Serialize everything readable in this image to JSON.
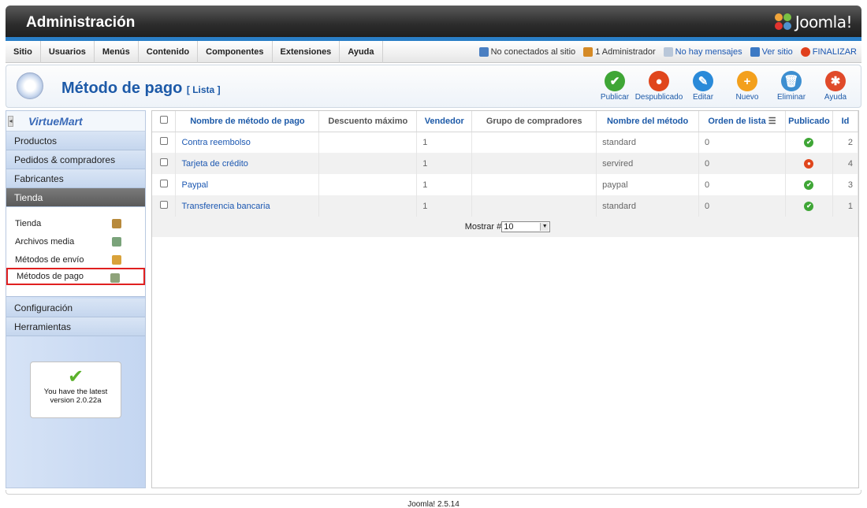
{
  "header": {
    "title": "Administración",
    "logo_text": "Joomla!"
  },
  "menu": [
    "Sitio",
    "Usuarios",
    "Menús",
    "Contenido",
    "Componentes",
    "Extensiones",
    "Ayuda"
  ],
  "status": {
    "visitors": "No conectados al sitio",
    "admins": "1 Administrador",
    "messages": "No hay mensajes",
    "view_site": "Ver sitio",
    "logout": "FINALIZAR"
  },
  "page": {
    "title": "Método de pago",
    "subtitle": "[ Lista ]"
  },
  "toolbar": [
    {
      "label": "Publicar",
      "icon": "check-icon",
      "color": "#3fa636",
      "glyph": "✔"
    },
    {
      "label": "Despublicado",
      "icon": "unpublish-icon",
      "color": "#e0461c",
      "glyph": "●"
    },
    {
      "label": "Editar",
      "icon": "pencil-icon",
      "color": "#2a8ad9",
      "glyph": "✎"
    },
    {
      "label": "Nuevo",
      "icon": "plus-icon",
      "color": "#f3a01d",
      "glyph": "+"
    },
    {
      "label": "Eliminar",
      "icon": "trash-icon",
      "color": "#3d8fd1",
      "glyph": "🗑"
    },
    {
      "label": "Ayuda",
      "icon": "help-lifebuoy-icon",
      "color": "#e04a2a",
      "glyph": "✱"
    }
  ],
  "sidebar": {
    "logo": "VirtueMart",
    "sections": [
      "Productos",
      "Pedidos & compradores",
      "Fabricantes",
      "Tienda"
    ],
    "sub_items": [
      {
        "label": "Tienda",
        "icon": "shop-icon",
        "color": "#b88a3c"
      },
      {
        "label": "Archivos media",
        "icon": "media-icon",
        "color": "#7aa37a"
      },
      {
        "label": "Métodos de envío",
        "icon": "truck-icon",
        "color": "#d9a23a"
      },
      {
        "label": "Métodos de pago",
        "icon": "payment-icon",
        "color": "#8fa37a"
      }
    ],
    "bottom_sections": [
      "Configuración",
      "Herramientas"
    ],
    "version_text": "You have the latest version 2.0.22a"
  },
  "table": {
    "headers": {
      "name": "Nombre de método de pago",
      "discount": "Descuento máximo",
      "vendor": "Vendedor",
      "group": "Grupo de compradores",
      "method": "Nombre del método",
      "order": "Orden de lista",
      "published": "Publicado",
      "id": "Id"
    },
    "rows": [
      {
        "name": "Contra reembolso",
        "discount": "",
        "vendor": "1",
        "group": "",
        "method": "standard",
        "order": "0",
        "published": true,
        "id": "2"
      },
      {
        "name": "Tarjeta de crédito",
        "discount": "",
        "vendor": "1",
        "group": "",
        "method": "servired",
        "order": "0",
        "published": false,
        "id": "4"
      },
      {
        "name": "Paypal",
        "discount": "",
        "vendor": "1",
        "group": "",
        "method": "paypal",
        "order": "0",
        "published": true,
        "id": "3"
      },
      {
        "name": "Transferencia bancaria",
        "discount": "",
        "vendor": "1",
        "group": "",
        "method": "standard",
        "order": "0",
        "published": true,
        "id": "1"
      }
    ],
    "pager_label": "Mostrar #",
    "pager_value": "10"
  },
  "footer": "Joomla! 2.5.14"
}
